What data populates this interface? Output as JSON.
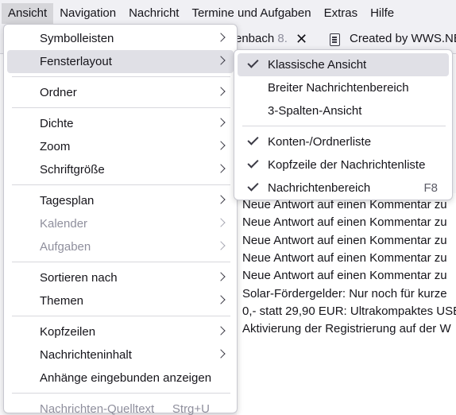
{
  "menubar": {
    "items": [
      {
        "label": "Ansicht",
        "name": "menubar-ansicht"
      },
      {
        "label": "Navigation",
        "name": "menubar-navigation"
      },
      {
        "label": "Nachricht",
        "name": "menubar-nachricht"
      },
      {
        "label": "Termine und Aufgaben",
        "name": "menubar-termine-aufgaben"
      },
      {
        "label": "Extras",
        "name": "menubar-extras"
      },
      {
        "label": "Hilfe",
        "name": "menubar-hilfe"
      }
    ]
  },
  "tabs": {
    "partial_title": "enbach",
    "partial_suffix": " 8.",
    "second_title": "Created by WWS.NE"
  },
  "view_menu": {
    "groups": [
      [
        {
          "label": "Symbolleisten",
          "submenu": true
        },
        {
          "label": "Fensterlayout",
          "submenu": true,
          "highlighted": true
        }
      ],
      [
        {
          "label": "Ordner",
          "submenu": true
        }
      ],
      [
        {
          "label": "Dichte",
          "submenu": true
        },
        {
          "label": "Zoom",
          "submenu": true
        },
        {
          "label": "Schriftgröße",
          "submenu": true
        }
      ],
      [
        {
          "label": "Tagesplan",
          "submenu": true
        },
        {
          "label": "Kalender",
          "submenu": true,
          "disabled": true
        },
        {
          "label": "Aufgaben",
          "submenu": true,
          "disabled": true
        }
      ],
      [
        {
          "label": "Sortieren nach",
          "submenu": true
        },
        {
          "label": "Themen",
          "submenu": true
        }
      ],
      [
        {
          "label": "Kopfzeilen",
          "submenu": true
        },
        {
          "label": "Nachrichteninhalt",
          "submenu": true
        },
        {
          "label": "Anhänge eingebunden anzeigen"
        }
      ],
      [
        {
          "label": "Nachrichten-Quelltext",
          "shortcut": "Strg+U",
          "disabled": true
        }
      ]
    ]
  },
  "layout_submenu": {
    "groups": [
      [
        {
          "label": "Klassische Ansicht",
          "checked": true,
          "highlighted": true
        },
        {
          "label": "Breiter Nachrichtenbereich",
          "checked": false
        },
        {
          "label": "3-Spalten-Ansicht",
          "checked": false
        }
      ],
      [
        {
          "label": "Konten-/Ordnerliste",
          "checked": true
        },
        {
          "label": "Kopfzeile der Nachrichtenliste",
          "checked": true
        },
        {
          "label": "Nachrichtenbereich",
          "checked": true,
          "shortcut": "F8"
        }
      ]
    ]
  },
  "message_list": {
    "rows": [
      "Neue Antwort auf einen Kommentar zu",
      "Neue Antwort auf einen Kommentar zu",
      "Neue Antwort auf einen Kommentar zu",
      "Neue Antwort auf einen Kommentar zu",
      "Neue Antwort auf einen Kommentar zu",
      "Solar-Fördergelder: Nur noch für kurze",
      "0,- statt 29,90 EUR: Ultrakompaktes USE",
      "Aktivierung der Registrierung auf der W"
    ]
  },
  "colors": {
    "menu_bg": "#ffffff",
    "highlight": "#e0e0e6",
    "disabled_text": "#8f8f9d",
    "menubar_bg": "#f0f0f4"
  }
}
